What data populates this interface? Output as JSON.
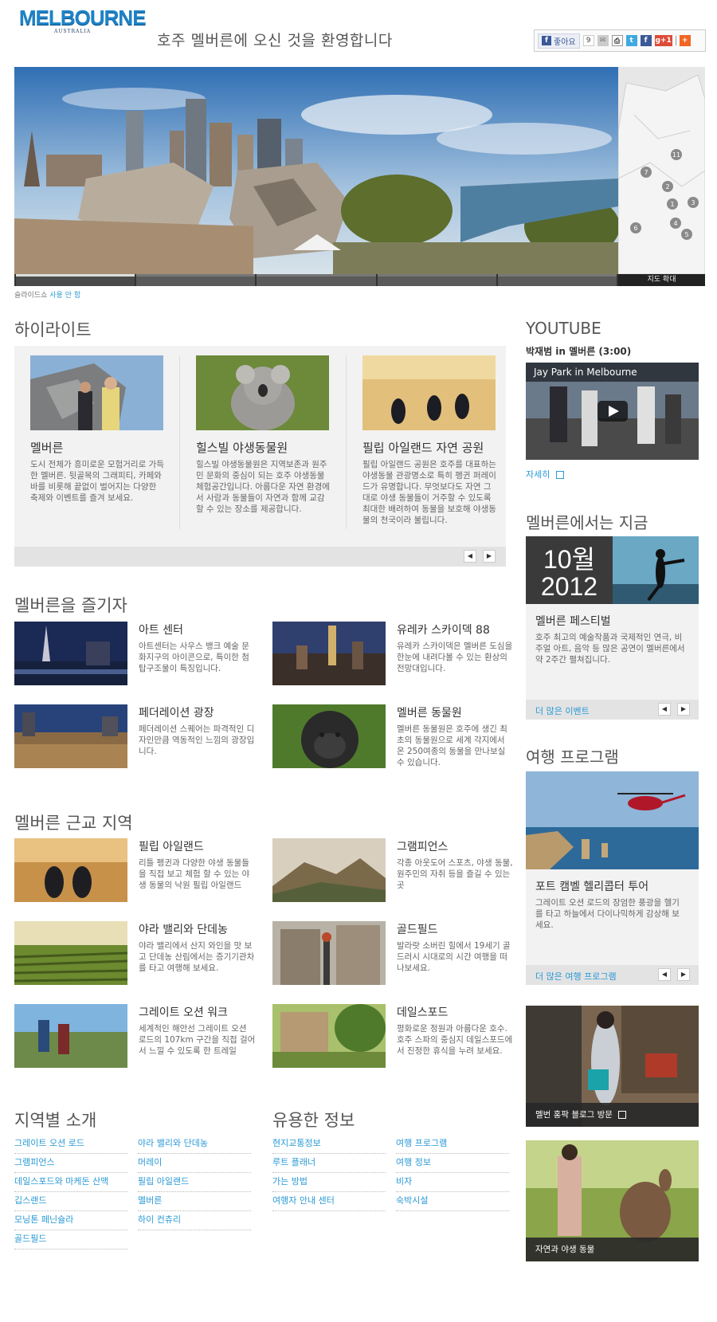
{
  "header": {
    "logo_text": "MELBOURNE",
    "logo_sub": "AUSTRALIA",
    "welcome": "호주 멜버른에 오신 것을 환영합니다",
    "like_label": "좋아요",
    "like_count": "9"
  },
  "hero": {
    "map_button": "지도 확대",
    "map_markers": [
      "11",
      "7",
      "2",
      "1",
      "3",
      "4",
      "6",
      "5"
    ],
    "slideshow_prefix": "슬라이드쇼",
    "slideshow_link": "사용 안 함"
  },
  "highlights": {
    "title": "하이라이트",
    "cards": [
      {
        "title": "멜버른",
        "text": "도시 전체가 흥미로운 모험거리로 가득한 멜버른. 뒷골목의 그래피티, 카페와 바를 비롯해 끝없이 벌어지는 다양한 축제와 이벤트를 즐겨 보세요."
      },
      {
        "title": "힐스빌 야생동물원",
        "text": "힐스빌 야생동물원은 지역보존과 원주민 문화의 중심이 되는 호주 야생동물 체험공간입니다. 아름다운 자연 환경에서 사람과 동물들이 자연과 함께 교감할 수 있는 장소를 제공합니다."
      },
      {
        "title": "필립 아일랜드 자연 공원",
        "text": "필립 아일랜드 공원은 호주를 대표하는 야생동물 관광명소로 특히 펭귄 퍼레이드가 유명합니다. 무엇보다도 자연 그대로 야생 동물들이 거주할 수 있도록 최대한 배려하여 동물을 보호해 야생동물의 천국이라 불립니다."
      }
    ]
  },
  "enjoy": {
    "title": "멜버른을 즐기자",
    "items": [
      {
        "title": "아트 센터",
        "text": "아트센터는 사우스 뱅크 예술 문화지구의 아이콘으로, 특이한 첨탑구조물이 특징입니다."
      },
      {
        "title": "유레카 스카이덱 88",
        "text": "유레카 스카이덱은 멜버른 도심을 한눈에 내려다볼 수 있는 환상의 전망대입니다."
      },
      {
        "title": "페더레이션 광장",
        "text": "페더레이션 스퀘어는 파격적인 디자인만큼 역동적인 느낌의 광장입니다."
      },
      {
        "title": "멜버른 동물원",
        "text": "멜버른 동물원은 호주에 생긴 최초의 동물원으로 세계 각지에서 온 250여종의 동물을 만나보실 수 있습니다."
      }
    ]
  },
  "suburbs": {
    "title": "멜버른 근교 지역",
    "items": [
      {
        "title": "필립 아일랜드",
        "text": "리틀 펭귄과 다양한 야생 동물들을 직접 보고 체험 할 수 있는 야생 동물의 낙원 필립 아일랜드"
      },
      {
        "title": "그램피언스",
        "text": "각종 아웃도어 스포츠, 야생 동물, 원주민의 자취 등을 즐길 수 있는 곳"
      },
      {
        "title": "야라 밸리와 단데농",
        "text": "야라 밸리에서 산지 와인을 맛 보고 단데농 산림에서는 증기기관차를 타고 여행해 보세요."
      },
      {
        "title": "골드필드",
        "text": "발라랏 소버린 힐에서 19세기 골드러시 시대로의 시간 여행을 떠나보세요."
      },
      {
        "title": "그레이트 오션 워크",
        "text": "세계적인 해안선 그레이트 오션 로드의 107km 구간을 직접 걸어서 느낄 수 있도록 한 트레일"
      },
      {
        "title": "데일스포드",
        "text": "평화로운 정원과 아름다운 호수. 호주 스파의 중심지 데일스포드에서 진정한 휴식을 누려 보세요."
      }
    ]
  },
  "regions": {
    "title": "지역별 소개",
    "col1": [
      "그레이트 오션 로드",
      "그램피언스",
      "데일스포드와 마케돈 산맥",
      "깁스랜드",
      "모닝톤 페닌슐라",
      "골드필드"
    ],
    "col2": [
      "야라 밸리와 단데농",
      "머레이",
      "필립 아일랜드",
      "멜버른",
      "하이 컨츄리"
    ]
  },
  "info": {
    "title": "유용한 정보",
    "col1": [
      "현지교통정보",
      "루트 플래너",
      "가는 방법",
      "여행자 안내 센터"
    ],
    "col2": [
      "여행 프로그램",
      "여행 정보",
      "비자",
      "숙박시설"
    ]
  },
  "sidebar": {
    "youtube_title": "YOUTUBE",
    "youtube_sub": "박재범 in 멜버른 (3:00)",
    "video_title": "Jay Park in Melbourne",
    "youtube_more": "자세히",
    "now_title": "멜버른에서는 지금",
    "now_month": "10월",
    "now_year": "2012",
    "event_title": "멜버른 페스티벌",
    "event_text": "호주 최고의 예술작품과 국제적인 연극, 비주얼 아트, 음악 등 많은 공연이 멜버른에서 약 2주간 펼쳐집니다.",
    "event_more": "더 많은 이벤트",
    "trip_title": "여행 프로그램",
    "trip_item_title": "포트 캠벨 헬리콥터 투어",
    "trip_item_text": "그레이트 오션 로드의 장엄한 풍광을 헬기를 타고 하늘에서 다이나믹하게 감상해 보세요.",
    "trip_more": "더 많은 여행 프로그램",
    "promo1": "멜번 홍팍 블로그 방문",
    "promo2": "자연과 야생 동물"
  },
  "colors": {
    "link": "#2a9ad6",
    "logo": "#1d83c8",
    "panel": "#f2f2f2"
  }
}
